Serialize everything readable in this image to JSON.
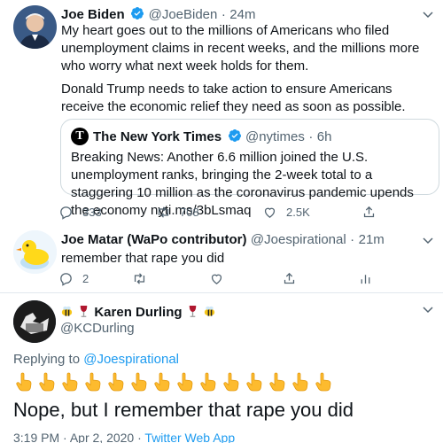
{
  "tweet1": {
    "name": "Joe Biden",
    "handle": "@JoeBiden",
    "time": "24m",
    "paragraph1": "My heart goes out to the millions of Americans who filed unemployment claims in recent weeks, and the millions more who worry what next week holds for them.",
    "paragraph2": "Donald Trump needs to take action to ensure Americans receive the economic relief they need as soon as possible.",
    "quote": {
      "logo": "T",
      "name": "The New York Times",
      "handle": "@nytimes",
      "time": "6h",
      "text": "Breaking News: Another 6.6 million joined the U.S. unemployment ranks, bringing the 2-week total to a staggering 10 million as the coronavirus pandemic upends the economy nyti.ms/3bLsmaq"
    },
    "actions": {
      "replies": "333",
      "retweets": "708",
      "likes": "2.5K"
    }
  },
  "tweet2": {
    "name": "Joe Matar (WaPo contributor)",
    "handle": "@Joespirational",
    "time": "21m",
    "text": "remember that rape you did",
    "actions": {
      "replies": "2"
    }
  },
  "tweet3": {
    "name": "Karen Durling",
    "handle": "@KCDurling",
    "replying_prefix": "Replying to",
    "replying_to": "@Joespirational",
    "emoji_count": 14,
    "text": "Nope, but I remember that rape you did",
    "time": "3:19 PM",
    "date": "Apr 2, 2020",
    "source": "Twitter Web App"
  },
  "separator_dot": "·",
  "icons": [
    "verified-badge-icon",
    "chevron-down-icon",
    "reply-icon",
    "retweet-icon",
    "like-icon",
    "share-icon",
    "analytics-icon",
    "bee-icon",
    "wine-glass-icon",
    "pointing-hand-icon"
  ],
  "colors": {
    "accent": "#1d9bf0",
    "text": "#0f1419",
    "secondary": "#536471",
    "border": "#cfd9de"
  }
}
